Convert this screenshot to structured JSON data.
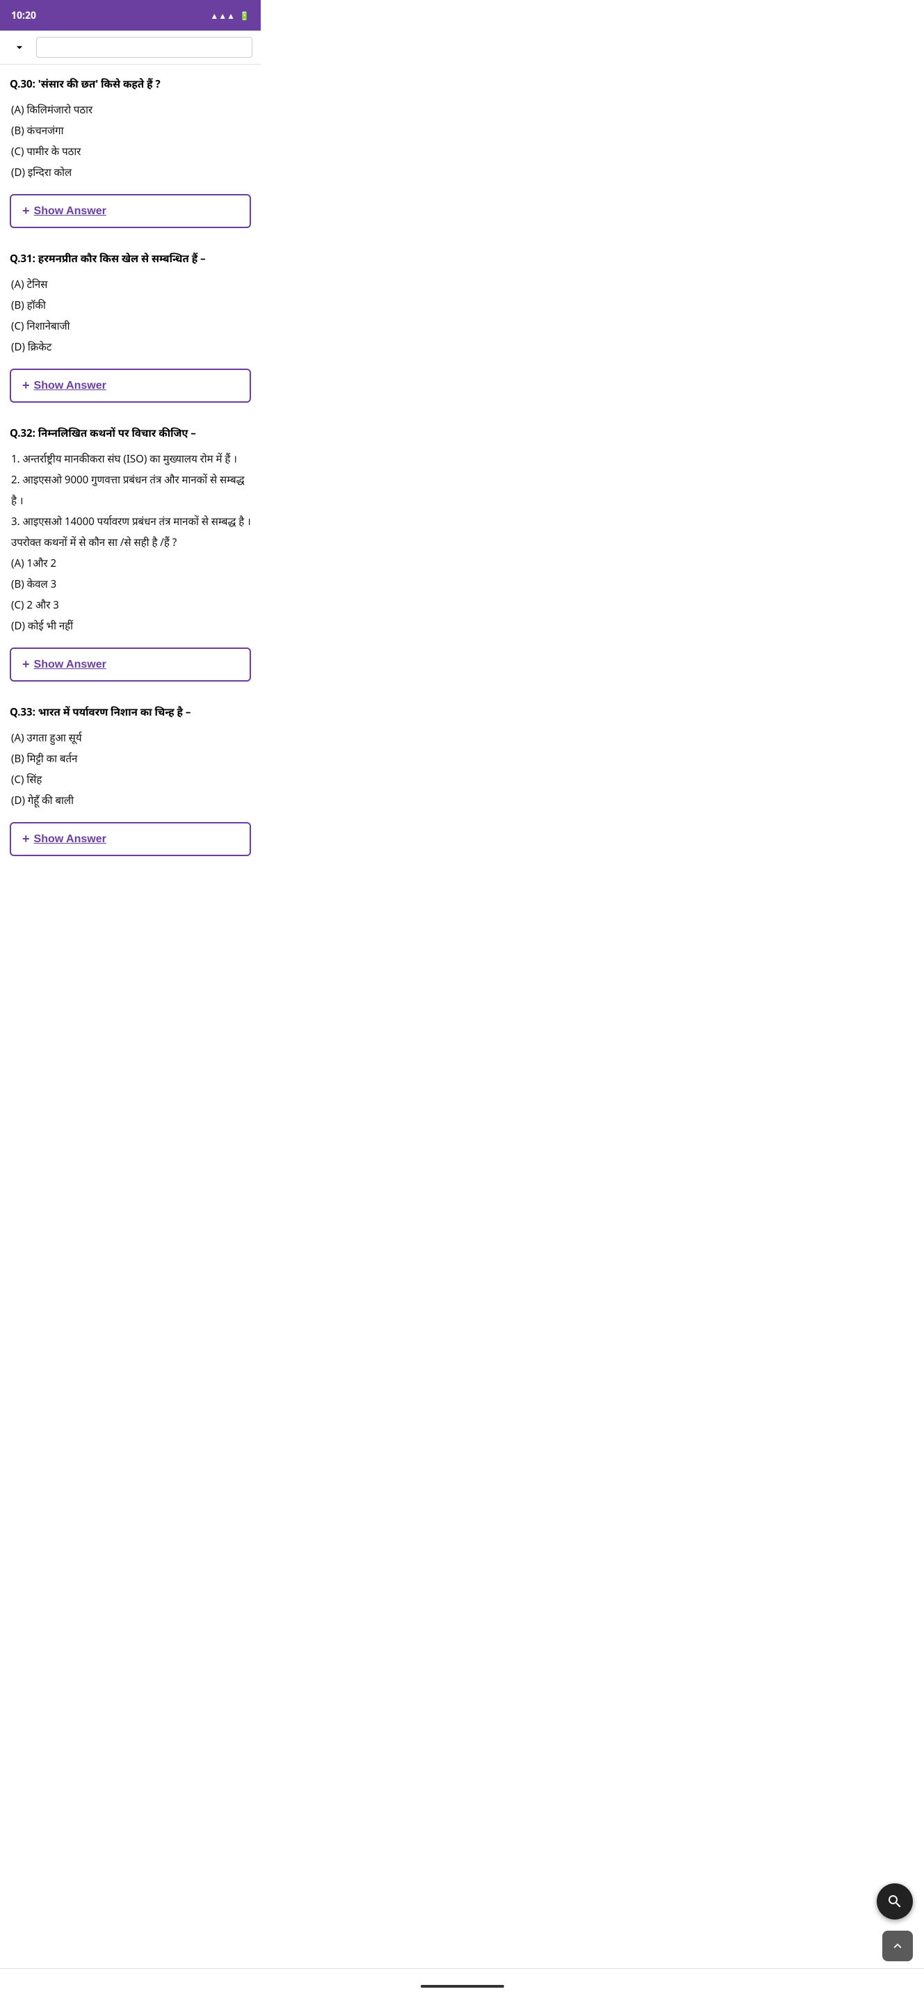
{
  "statusBar": {
    "time": "10:20",
    "icons": "📶 🔋"
  },
  "topBar": {
    "backLabel": "⌄",
    "searchPlaceholder": ""
  },
  "questions": [
    {
      "id": "q30",
      "prefix": "Q.30:",
      "text": " 'संसार की छत' किसे कहते हैं ?",
      "options": [
        "(A) किलिमंजारो पठार",
        "(B) कंचनजंगा",
        "(C) पामीर के पठार",
        "(D) इन्दिरा कोल"
      ],
      "showAnswerLabel": "Show Answer"
    },
    {
      "id": "q31",
      "prefix": "Q.31:",
      "text": " हरमनप्रीत कौर किस खेल से सम्बन्धित हैं –",
      "options": [
        "(A) टेनिस",
        "(B) हॉकी",
        "(C) निशानेबाजी",
        "(D) क्रिकेट"
      ],
      "showAnswerLabel": "Show Answer"
    },
    {
      "id": "q32",
      "prefix": "Q.32:",
      "text": " निम्नलिखित कथनों पर विचार कीजिए –",
      "statements": [
        "1. अन्तर्राष्ट्रीय मानकीकरा संघ (ISO) का मुख्यालय रोम में हैं ।",
        "2. आइएसओ 9000 गुणवत्ता प्रबंधन तंत्र और मानकों से सम्बद्ध है ।",
        "3. आइएसओ 14000 पर्यावरण प्रबंधन तंत्र मानकों से सम्बद्ध है ।",
        "उपरोक्त कथनों में से कौन सा /से सही है /हैं ?"
      ],
      "options": [
        "(A) 1और 2",
        "(B) केवल 3",
        "(C) 2 और 3",
        "(D) कोई भी नहीं"
      ],
      "showAnswerLabel": "Show Answer"
    },
    {
      "id": "q33",
      "prefix": "Q.33:",
      "text": " भारत में पर्यावरण निशान का चिन्ह है –",
      "options": [
        "(A) उगता हुआ सूर्य",
        "(B) मिट्टी का बर्तन",
        "(C) सिंह",
        "(D) गेहूँ की बाली"
      ],
      "showAnswerLabel": "Show Answer"
    }
  ],
  "fab": {
    "searchLabel": "search",
    "topLabel": "scroll-top"
  }
}
